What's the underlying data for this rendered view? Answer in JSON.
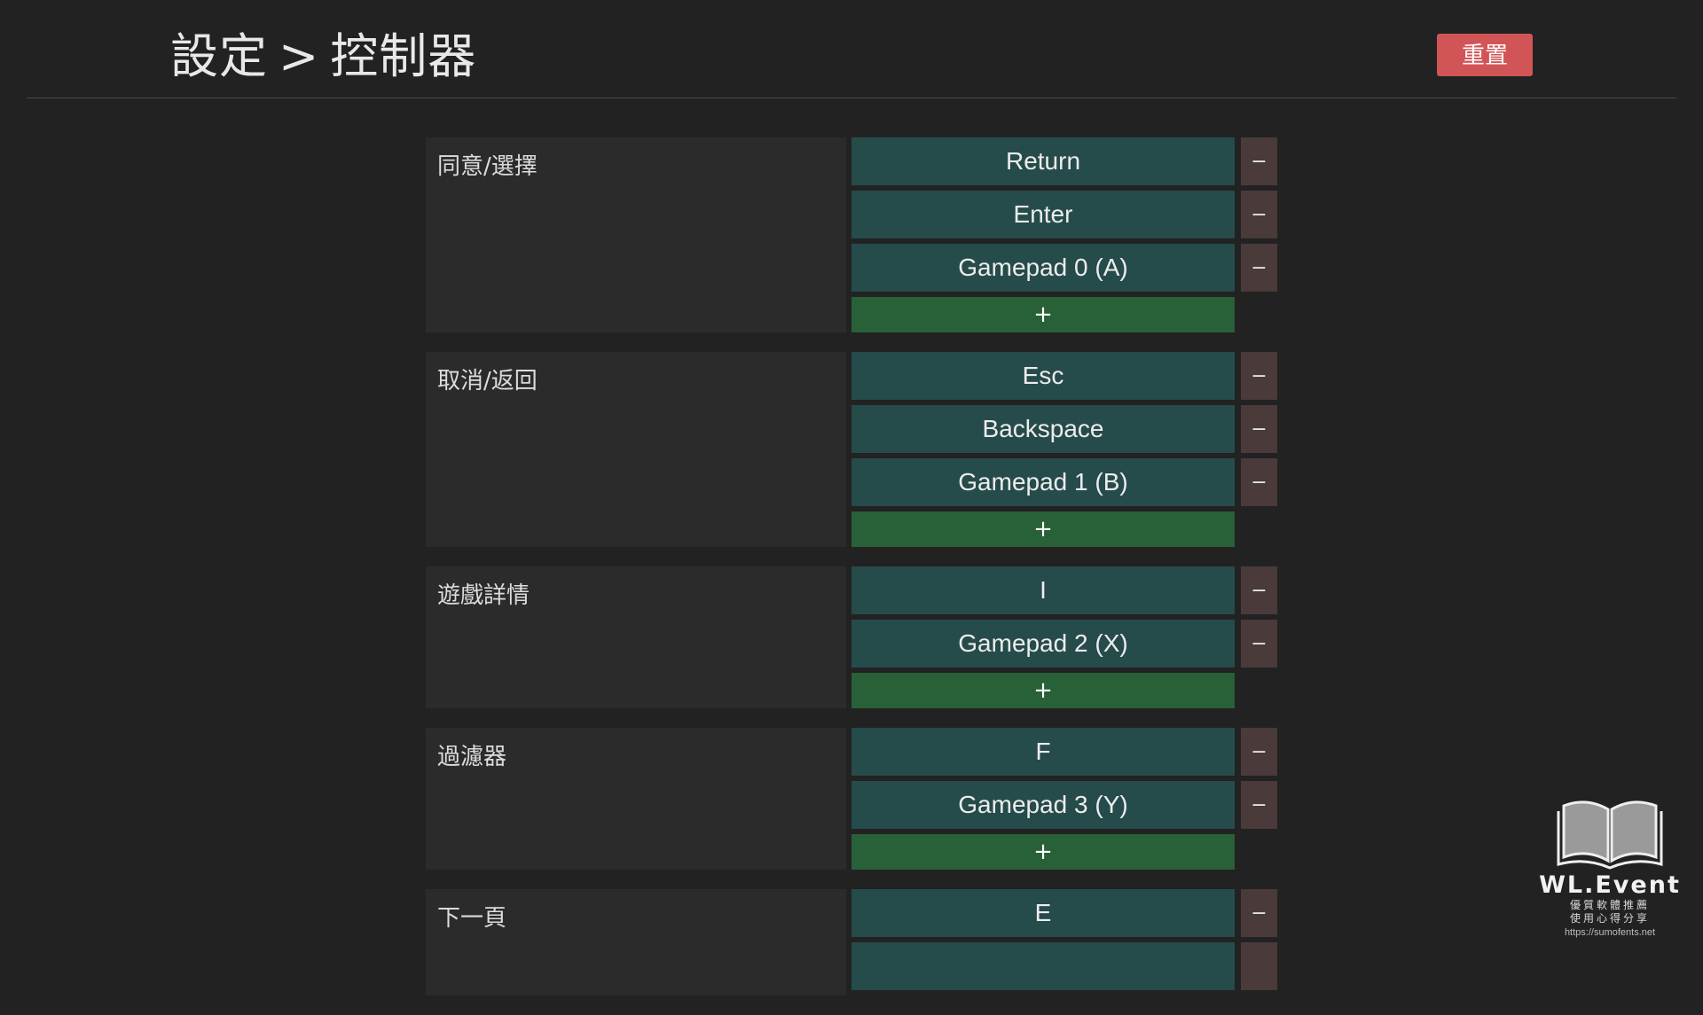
{
  "header": {
    "crumb_root": "設定",
    "crumb_sep": ">",
    "crumb_current": "控制器",
    "reset_label": "重置"
  },
  "groups": [
    {
      "label": "同意/選擇",
      "bindings": [
        "Return",
        "Enter",
        "Gamepad 0 (A)"
      ]
    },
    {
      "label": "取消/返回",
      "bindings": [
        "Esc",
        "Backspace",
        "Gamepad 1 (B)"
      ]
    },
    {
      "label": "遊戲詳情",
      "bindings": [
        "I",
        "Gamepad 2 (X)"
      ]
    },
    {
      "label": "過濾器",
      "bindings": [
        "F",
        "Gamepad 3 (Y)"
      ]
    },
    {
      "label": "下一頁",
      "bindings": [
        "E"
      ]
    }
  ],
  "remove_label": "−",
  "add_label": "+",
  "watermark": {
    "brand": "WL.Event",
    "line1": "優質軟體推薦",
    "line2": "使用心得分享",
    "url": "https://sumofents.net"
  },
  "colors": {
    "background": "#222222",
    "binding": "#264b4b",
    "remove": "#4a3a3a",
    "add": "#286038",
    "reset": "#d15556"
  }
}
